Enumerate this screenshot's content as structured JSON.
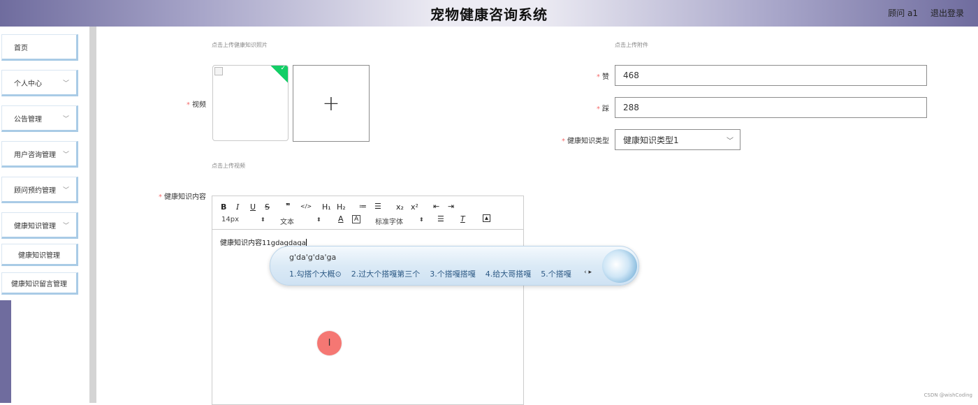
{
  "header": {
    "title": "宠物健康咨询系统",
    "user": "顾问 a1",
    "logout": "退出登录"
  },
  "sidebar": {
    "items": [
      {
        "label": "首页"
      },
      {
        "label": "个人中心",
        "chevron": "﹀"
      },
      {
        "label": "公告管理",
        "chevron": "﹀"
      },
      {
        "label": "用户咨询管理",
        "chevron": "﹀"
      },
      {
        "label": "顾问预约管理",
        "chevron": "﹀"
      },
      {
        "label": "健康知识管理",
        "chevron": "﹀"
      }
    ],
    "sub_items": [
      {
        "label": "健康知识管理"
      },
      {
        "label": "健康知识留言管理"
      }
    ]
  },
  "form": {
    "photo_hint": "点击上传健康知识照片",
    "attachment_hint": "点击上传附件",
    "video_label": "视频",
    "video_hint": "点击上传视频",
    "upload_plus": "+",
    "likes_label": "赞",
    "likes_value": "468",
    "dislikes_label": "踩",
    "dislikes_value": "288",
    "category_label": "健康知识类型",
    "category_value": "健康知识类型1",
    "content_label": "健康知识内容"
  },
  "editor": {
    "toolbar_row1": [
      "B",
      "I",
      "U",
      "S",
      "❞",
      "</>",
      "H₁",
      "H₂",
      "≔",
      "☰",
      "x₂",
      "x²",
      "⇤",
      "⇥"
    ],
    "font_size": "14px",
    "text_style": "文本",
    "font_family": "标准字体",
    "content": "健康知识内容11gdagdaga"
  },
  "ime": {
    "pinyin": "g'da'g'da'ga",
    "candidates": [
      "1.勾搭个大概⊙",
      "2.过大个搭嘎第三个",
      "3.个搭嘎搭嘎",
      "4.给大哥搭嘎",
      "5.个搭嘎"
    ],
    "nav": "‹ ▸"
  },
  "cursor_glyph": "I",
  "watermark": "CSDN @wishCoding",
  "colors": {
    "required": "#f56c6c",
    "success": "#13ce66",
    "header": "#6f6c9e",
    "nav_border": "#a9cbe6"
  }
}
